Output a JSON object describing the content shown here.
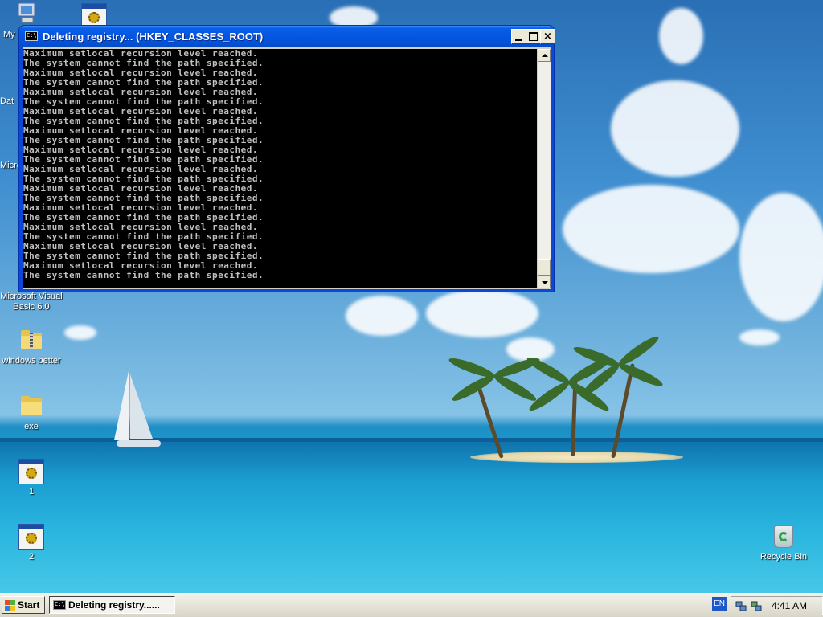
{
  "desktop": {
    "icons": [
      {
        "label": "My",
        "icon": "computer-icon"
      },
      {
        "label": "",
        "icon": "exe-icon"
      },
      {
        "label": "Dat",
        "icon": "partial-icon"
      },
      {
        "label": "Micro C",
        "icon": "partial-icon"
      },
      {
        "label": "Microsoft Visual Basic 6.0",
        "icon": "vb6-icon"
      },
      {
        "label": "windows better",
        "icon": "zip-folder-icon"
      },
      {
        "label": "exe",
        "icon": "folder-icon"
      },
      {
        "label": "1",
        "icon": "exe-icon"
      },
      {
        "label": "2",
        "icon": "exe-icon"
      },
      {
        "label": "Recycle Bin",
        "icon": "recycle-bin-icon"
      }
    ]
  },
  "window": {
    "title": "Deleting registry... (HKEY_CLASSES_ROOT)",
    "icon_text": "C:\\",
    "controls": {
      "minimize": "minimize",
      "maximize": "maximize",
      "close": "×"
    },
    "console_lines": [
      "Maximum setlocal recursion level reached.",
      "The system cannot find the path specified.",
      "Maximum setlocal recursion level reached.",
      "The system cannot find the path specified.",
      "Maximum setlocal recursion level reached.",
      "The system cannot find the path specified.",
      "Maximum setlocal recursion level reached.",
      "The system cannot find the path specified.",
      "Maximum setlocal recursion level reached.",
      "The system cannot find the path specified.",
      "Maximum setlocal recursion level reached.",
      "The system cannot find the path specified.",
      "Maximum setlocal recursion level reached.",
      "The system cannot find the path specified.",
      "Maximum setlocal recursion level reached.",
      "The system cannot find the path specified.",
      "Maximum setlocal recursion level reached.",
      "The system cannot find the path specified.",
      "Maximum setlocal recursion level reached.",
      "The system cannot find the path specified.",
      "Maximum setlocal recursion level reached.",
      "The system cannot find the path specified.",
      "Maximum setlocal recursion level reached.",
      "The system cannot find the path specified."
    ]
  },
  "taskbar": {
    "start_label": "Start",
    "task_label": "Deleting registry......",
    "language": "EN",
    "clock": "4:41 AM"
  },
  "colors": {
    "titlebar": "#0a5ee8",
    "console_bg": "#000000",
    "console_fg": "#c0c0c0"
  }
}
